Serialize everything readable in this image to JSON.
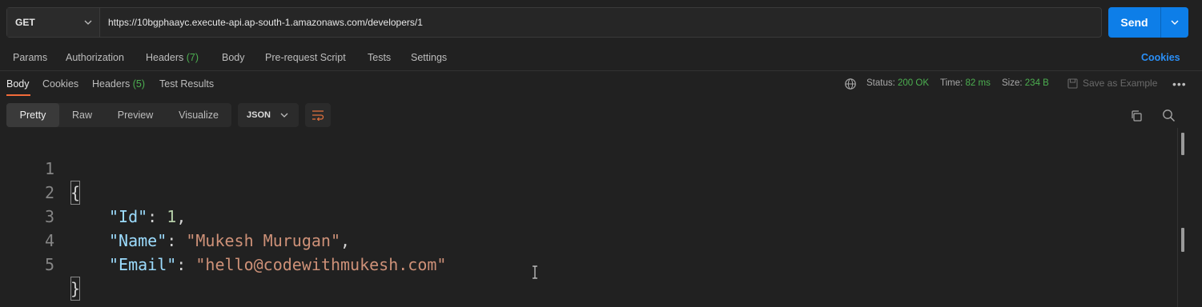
{
  "request": {
    "method": "GET",
    "url": "https://10bgphaayc.execute-api.ap-south-1.amazonaws.com/developers/1",
    "send_label": "Send"
  },
  "request_tabs": {
    "params": "Params",
    "authorization": "Authorization",
    "headers": "Headers",
    "headers_count": "(7)",
    "body": "Body",
    "prerequest": "Pre-request Script",
    "tests": "Tests",
    "settings": "Settings",
    "cookies": "Cookies"
  },
  "response_tabs": {
    "body": "Body",
    "cookies": "Cookies",
    "headers": "Headers",
    "headers_count": "(5)",
    "test_results": "Test Results"
  },
  "response_meta": {
    "status_label": "Status:",
    "status_value": "200 OK",
    "time_label": "Time:",
    "time_value": "82 ms",
    "size_label": "Size:",
    "size_value": "234 B",
    "save_example": "Save as Example"
  },
  "view_modes": {
    "pretty": "Pretty",
    "raw": "Raw",
    "preview": "Preview",
    "visualize": "Visualize",
    "format": "JSON"
  },
  "code_lines": [
    {
      "n": "1",
      "text": "{"
    },
    {
      "n": "2",
      "key": "\"Id\"",
      "sep": ": ",
      "val": "1",
      "tail": ","
    },
    {
      "n": "3",
      "key": "\"Name\"",
      "sep": ": ",
      "val": "\"Mukesh Murugan\"",
      "tail": ","
    },
    {
      "n": "4",
      "key": "\"Email\"",
      "sep": ": ",
      "val": "\"hello@codewithmukesh.com\"",
      "tail": ""
    },
    {
      "n": "5",
      "text": "}"
    }
  ],
  "colors": {
    "accent_blue": "#0d7ee8",
    "status_green": "#4caf50",
    "tab_underline": "#f26b3a"
  }
}
